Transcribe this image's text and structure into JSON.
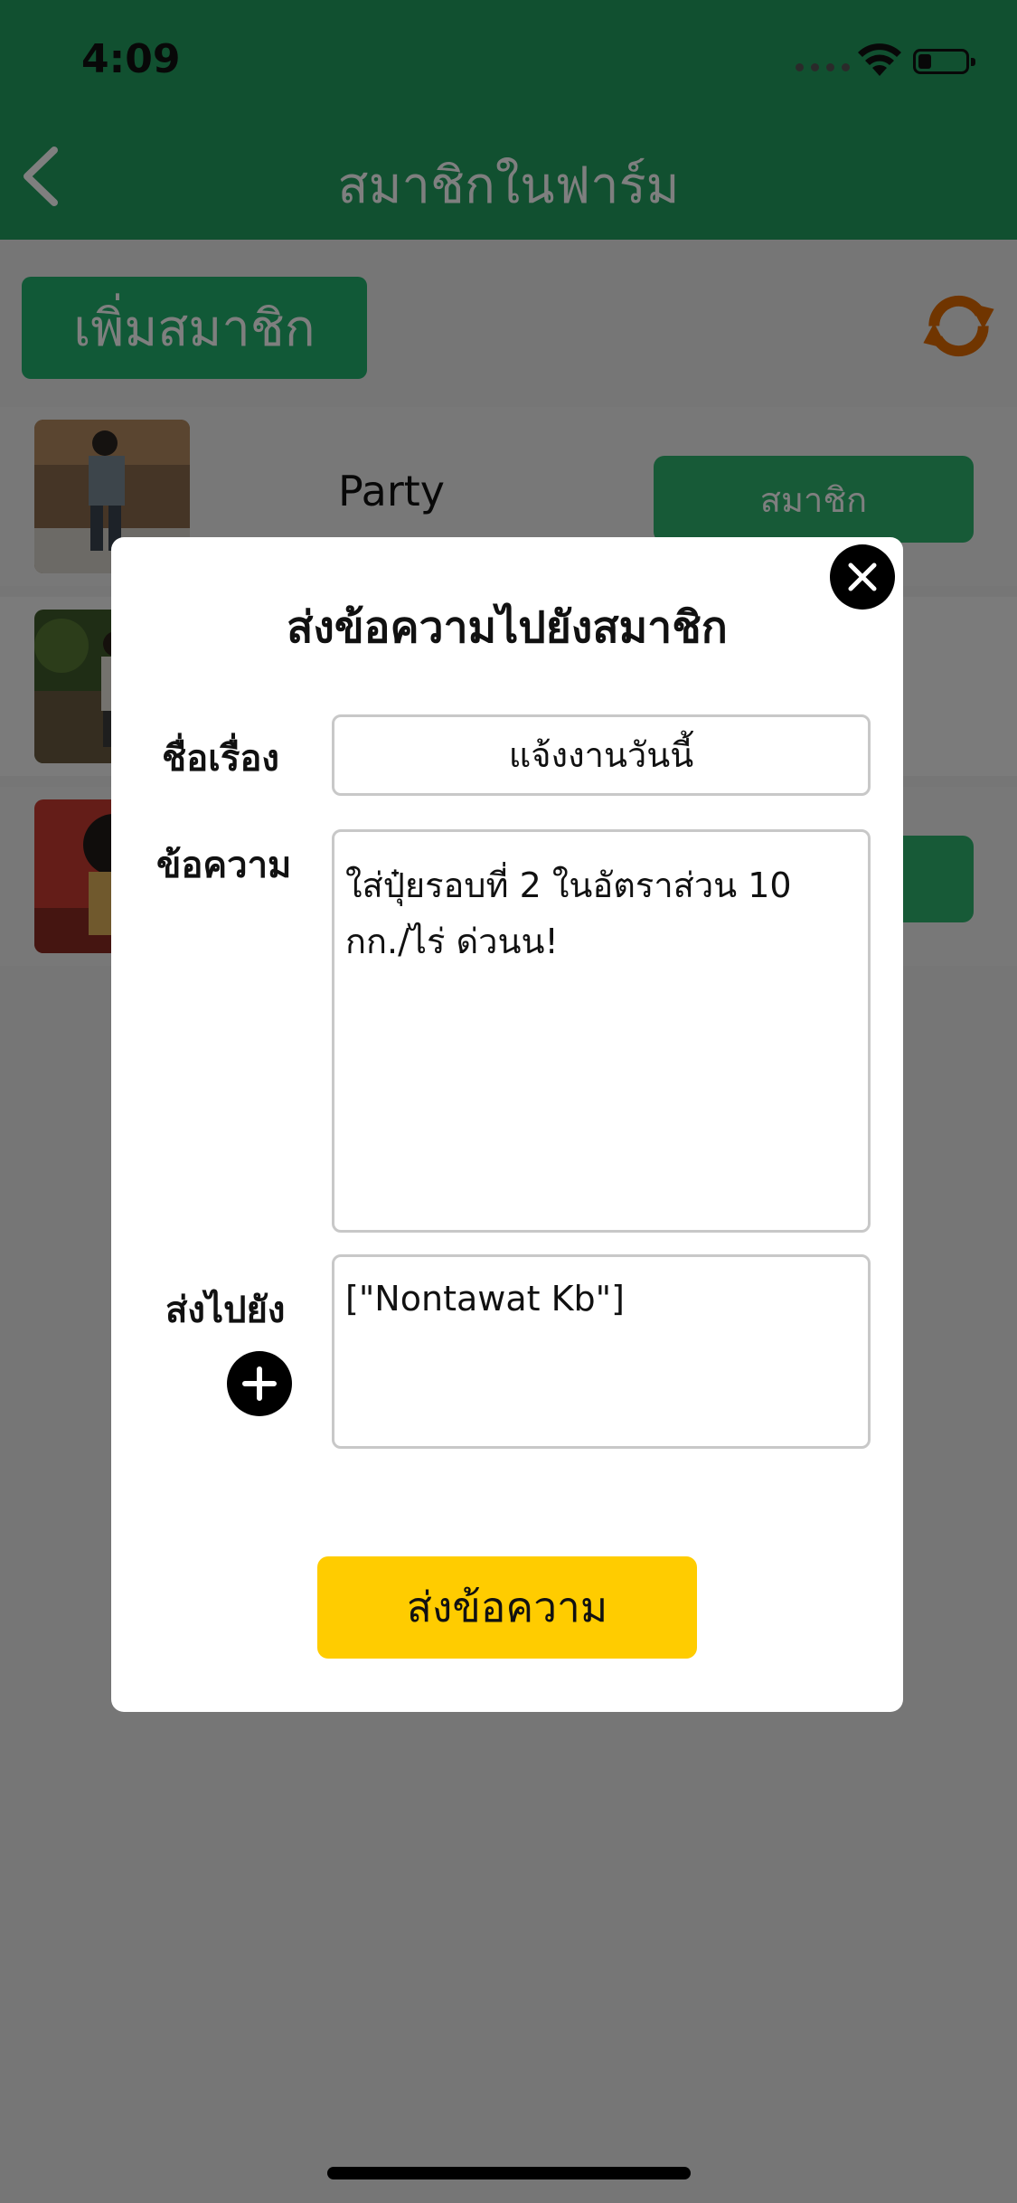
{
  "status": {
    "time": "4:09"
  },
  "nav": {
    "title": "สมาชิกในฟาร์ม",
    "back_icon": "chevron-left-icon"
  },
  "toolbar": {
    "add_member_label": "เพิ่มสมาชิก",
    "refresh_icon": "refresh-icon"
  },
  "members": [
    {
      "name": "Party",
      "role_label": "สมาชิก"
    },
    {
      "name": "",
      "role_label": ""
    },
    {
      "name": "",
      "role_label": ""
    }
  ],
  "modal": {
    "title": "ส่งข้อความไปยังสมาชิก",
    "subject_label": "ชื่อเรื่อง",
    "subject_value": "แจ้งงานวันนี้",
    "message_label": "ข้อความ",
    "message_value": "ใส่ปุ๋ยรอบที่ 2 ในอัตราส่วน 10\nกก./ไร่ ด่วนน!",
    "recipients_label": "ส่งไปยัง",
    "recipients_value": "[\"Nontawat Kb\"]",
    "send_label": "ส่งข้อความ"
  },
  "colors": {
    "primary_green": "#22a060",
    "button_green": "#22b36f",
    "send_yellow": "#ffcc00",
    "refresh_orange": "#e06a00"
  }
}
